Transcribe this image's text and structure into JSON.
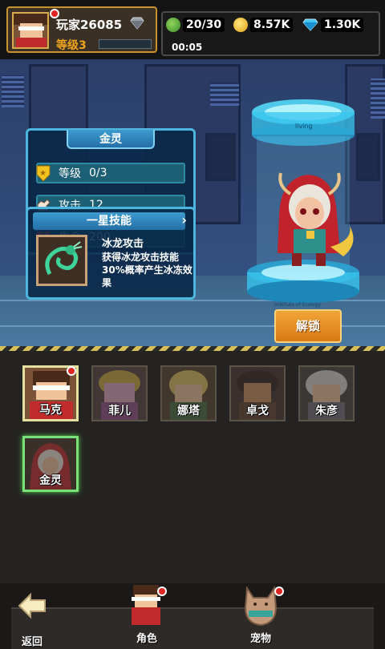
{
  "player": {
    "name": "玩家26085",
    "level": "等级3",
    "has_notification": true
  },
  "resources": {
    "stamina": "20/30",
    "gold": "8.57K",
    "diamonds": "1.30K",
    "timer": "00:05"
  },
  "hero": {
    "name": "金灵",
    "stats": [
      {
        "label": "等级",
        "value": "0/3",
        "icon": "star-shield-icon"
      },
      {
        "label": "攻击",
        "value": "12",
        "icon": "fist-icon"
      },
      {
        "label": "生命",
        "value": "200",
        "icon": "heart-icon"
      }
    ],
    "skill": {
      "title": "一星技能",
      "name": "冰龙攻击",
      "description": "获得冰龙攻击技能30%概率产生冰冻效果",
      "icon": "ice-dragon-icon"
    },
    "capsule_top_text": "living",
    "capsule_bottom_text": "Institute of Ecology"
  },
  "unlock_button": "解锁",
  "roster": [
    {
      "name": "马克",
      "locked": false,
      "has_notification": true
    },
    {
      "name": "菲儿",
      "locked": true,
      "has_notification": false
    },
    {
      "name": "娜塔",
      "locked": true,
      "has_notification": false
    },
    {
      "name": "卓戈",
      "locked": true,
      "has_notification": false
    },
    {
      "name": "朱彦",
      "locked": true,
      "has_notification": false
    },
    {
      "name": "金灵",
      "locked": true,
      "has_notification": false
    }
  ],
  "nav": {
    "back": "返回",
    "characters": "角色",
    "pets": "宠物"
  },
  "colors": {
    "accent_gold": "#c8922e",
    "panel_border": "#4db6df",
    "unlock_orange": "#e08a1c",
    "level_orange": "#f0a41e"
  }
}
